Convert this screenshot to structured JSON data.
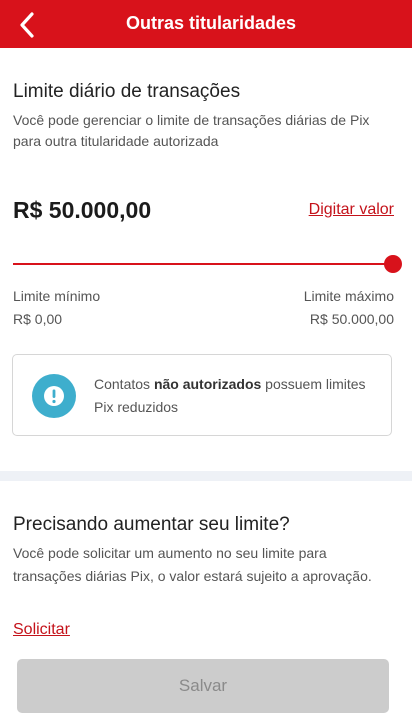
{
  "header": {
    "title": "Outras titularidades",
    "back_icon": "chevron-left-icon",
    "background": "#d8121b"
  },
  "limit_section": {
    "title": "Limite diário de transações",
    "description": "Você pode gerenciar o limite de transações diárias de Pix para outra titularidade autorizada",
    "amount": "R$ 50.000,00",
    "edit_link": "Digitar valor",
    "slider_percent": 100,
    "min_label": "Limite mínimo",
    "min_value": "R$ 0,00",
    "max_label": "Limite máximo",
    "max_value": "R$ 50.000,00"
  },
  "info_card": {
    "icon": "exclamation-circle-icon",
    "icon_color": "#3eaecd",
    "text_before": "Contatos ",
    "text_bold": "não autorizados",
    "text_after": " possuem limites Pix reduzidos"
  },
  "increase_section": {
    "title": "Precisando aumentar seu limite?",
    "description": "Você pode solicitar um aumento no seu limite para transações diárias Pix, o valor estará sujeito a aprovação.",
    "request_link": "Solicitar"
  },
  "footer": {
    "save_label": "Salvar"
  }
}
